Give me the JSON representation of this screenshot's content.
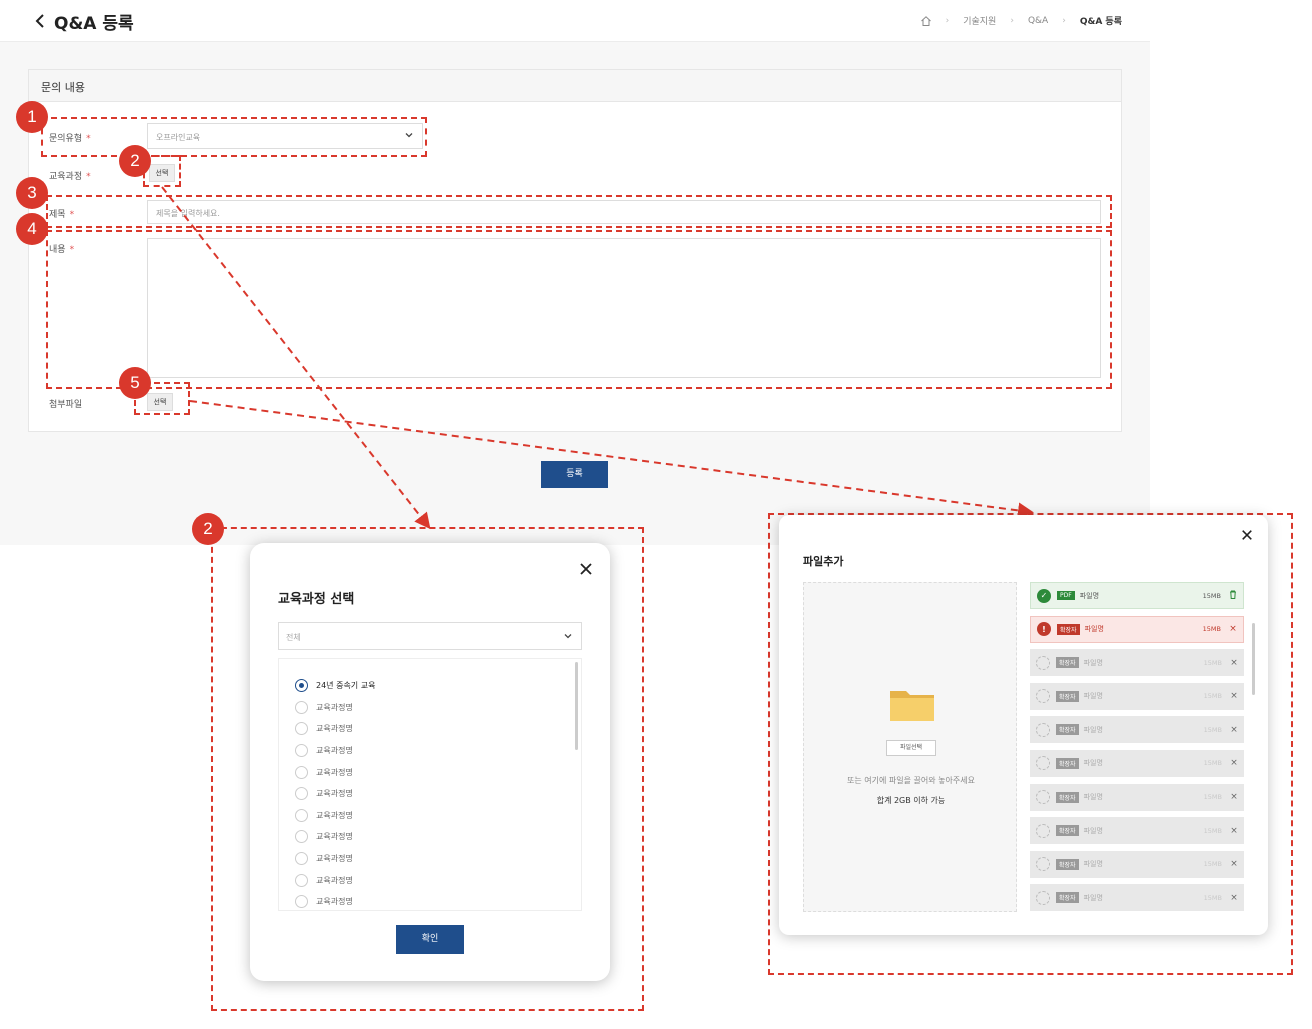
{
  "header": {
    "title": "Q&A 등록",
    "breadcrumb": [
      "기술지원",
      "Q&A",
      "Q&A 등록"
    ]
  },
  "form": {
    "section_title": "문의 내용",
    "type_label": "문의유형",
    "type_value": "오프라인교육",
    "course_label": "교육과정",
    "course_button": "선택",
    "subject_label": "제목",
    "subject_placeholder": "제목을 입력하세요.",
    "content_label": "내용",
    "attach_label": "첨부파일",
    "attach_button": "선택",
    "required_mark": "*",
    "submit_label": "등록"
  },
  "annotations": [
    "1",
    "2",
    "3",
    "4",
    "5",
    "2"
  ],
  "course_modal": {
    "title": "교육과정 선택",
    "filter_value": "전체",
    "items": [
      {
        "label": "24년 중속기 교육",
        "selected": true
      },
      {
        "label": "교육과정명",
        "selected": false
      },
      {
        "label": "교육과정명",
        "selected": false
      },
      {
        "label": "교육과정명",
        "selected": false
      },
      {
        "label": "교육과정명",
        "selected": false
      },
      {
        "label": "교육과정명",
        "selected": false
      },
      {
        "label": "교육과정명",
        "selected": false
      },
      {
        "label": "교육과정명",
        "selected": false
      },
      {
        "label": "교육과정명",
        "selected": false
      },
      {
        "label": "교육과정명",
        "selected": false
      },
      {
        "label": "교육과정명",
        "selected": false
      }
    ],
    "confirm_label": "확인"
  },
  "file_modal": {
    "title": "파일추가",
    "choose_button": "파일선택",
    "drop_hint": "또는 여기에 파일을 끌어와 놓아주세요",
    "size_limit": "합계 2GB 이하 가능",
    "files": [
      {
        "status": "success",
        "ext": "PDF",
        "name": "파일명",
        "size": "15MB",
        "action": "delete"
      },
      {
        "status": "error",
        "ext": "확장자",
        "name": "파일명",
        "size": "15MB",
        "action": "remove"
      },
      {
        "status": "pending",
        "ext": "확장자",
        "name": "파일명",
        "size": "15MB",
        "action": "remove"
      },
      {
        "status": "pending",
        "ext": "확장자",
        "name": "파일명",
        "size": "15MB",
        "action": "remove"
      },
      {
        "status": "pending",
        "ext": "확장자",
        "name": "파일명",
        "size": "15MB",
        "action": "remove"
      },
      {
        "status": "pending",
        "ext": "확장자",
        "name": "파일명",
        "size": "15MB",
        "action": "remove"
      },
      {
        "status": "pending",
        "ext": "확장자",
        "name": "파일명",
        "size": "15MB",
        "action": "remove"
      },
      {
        "status": "pending",
        "ext": "확장자",
        "name": "파일명",
        "size": "15MB",
        "action": "remove"
      },
      {
        "status": "pending",
        "ext": "확장자",
        "name": "파일명",
        "size": "15MB",
        "action": "remove"
      },
      {
        "status": "pending",
        "ext": "확장자",
        "name": "파일명",
        "size": "15MB",
        "action": "remove"
      }
    ]
  },
  "colors": {
    "primary": "#1f4e8c",
    "annotation": "#d9382c",
    "success": "#2d8a3a",
    "error": "#c0392b"
  }
}
